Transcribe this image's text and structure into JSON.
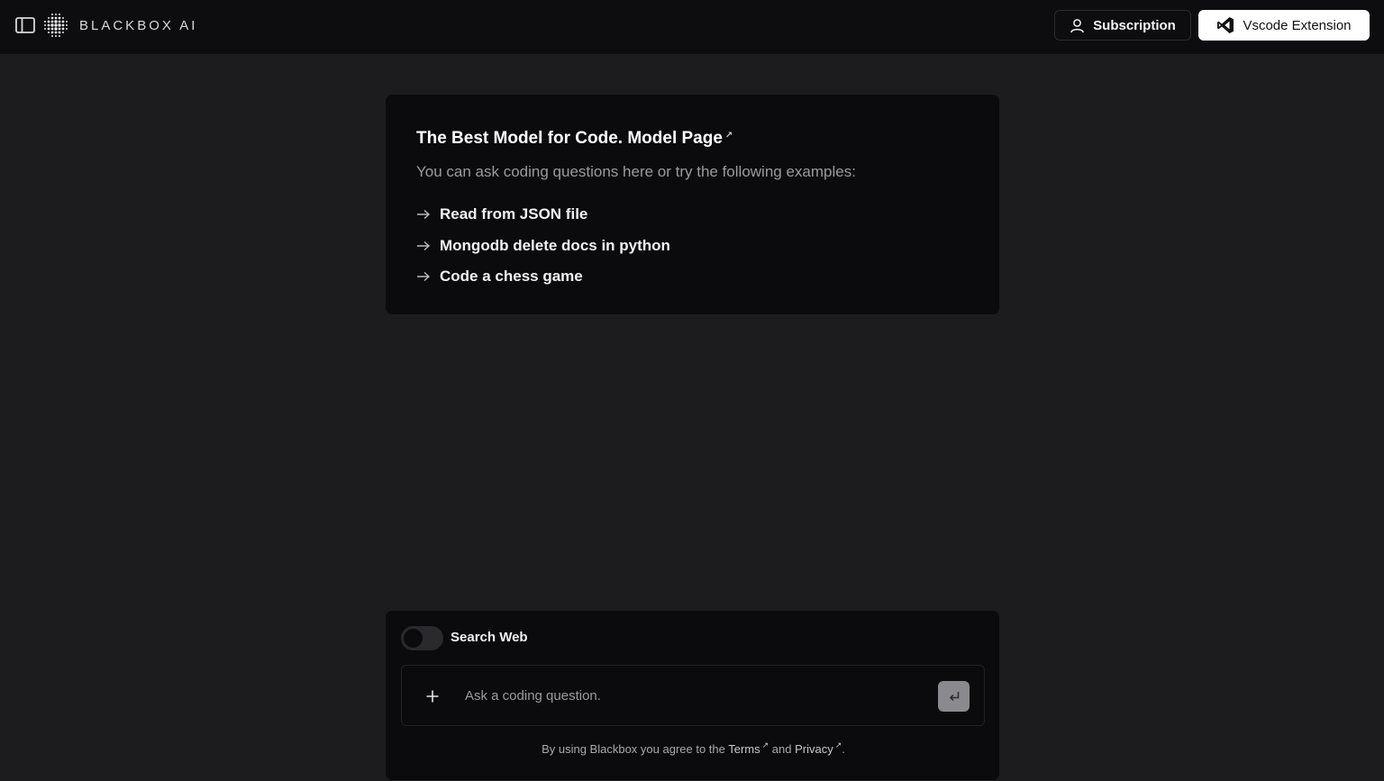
{
  "header": {
    "brand_name": "BLACKBOX AI",
    "subscription_label": "Subscription",
    "vscode_label": "Vscode Extension",
    "icons": {
      "sidebar": "sidebar-toggle-icon",
      "logo": "blackbox-dots-logo",
      "subscription": "user-icon",
      "vscode": "vscode-icon"
    }
  },
  "intro": {
    "title": "The Best Model for Code. Model Page",
    "title_link_icon": "↗",
    "subtitle": "You can ask coding questions here or try the following examples:",
    "examples": [
      "Read from JSON file",
      "Mongodb delete docs in python",
      "Code a chess game"
    ]
  },
  "composer": {
    "search_web_label": "Search Web",
    "search_web_enabled": false,
    "placeholder": "Ask a coding question.",
    "value": ""
  },
  "footer": {
    "prefix": "By using Blackbox you agree to the ",
    "terms_label": "Terms",
    "middle": " and ",
    "privacy_label": "Privacy",
    "suffix": ".",
    "link_icon": "↗"
  },
  "colors": {
    "page_bg": "#1c1c1f",
    "topbar_bg": "#0d0d0f",
    "card_bg": "#0b0b0d",
    "muted_text": "#9a9aa0",
    "send_button": "#8a8a8e"
  }
}
